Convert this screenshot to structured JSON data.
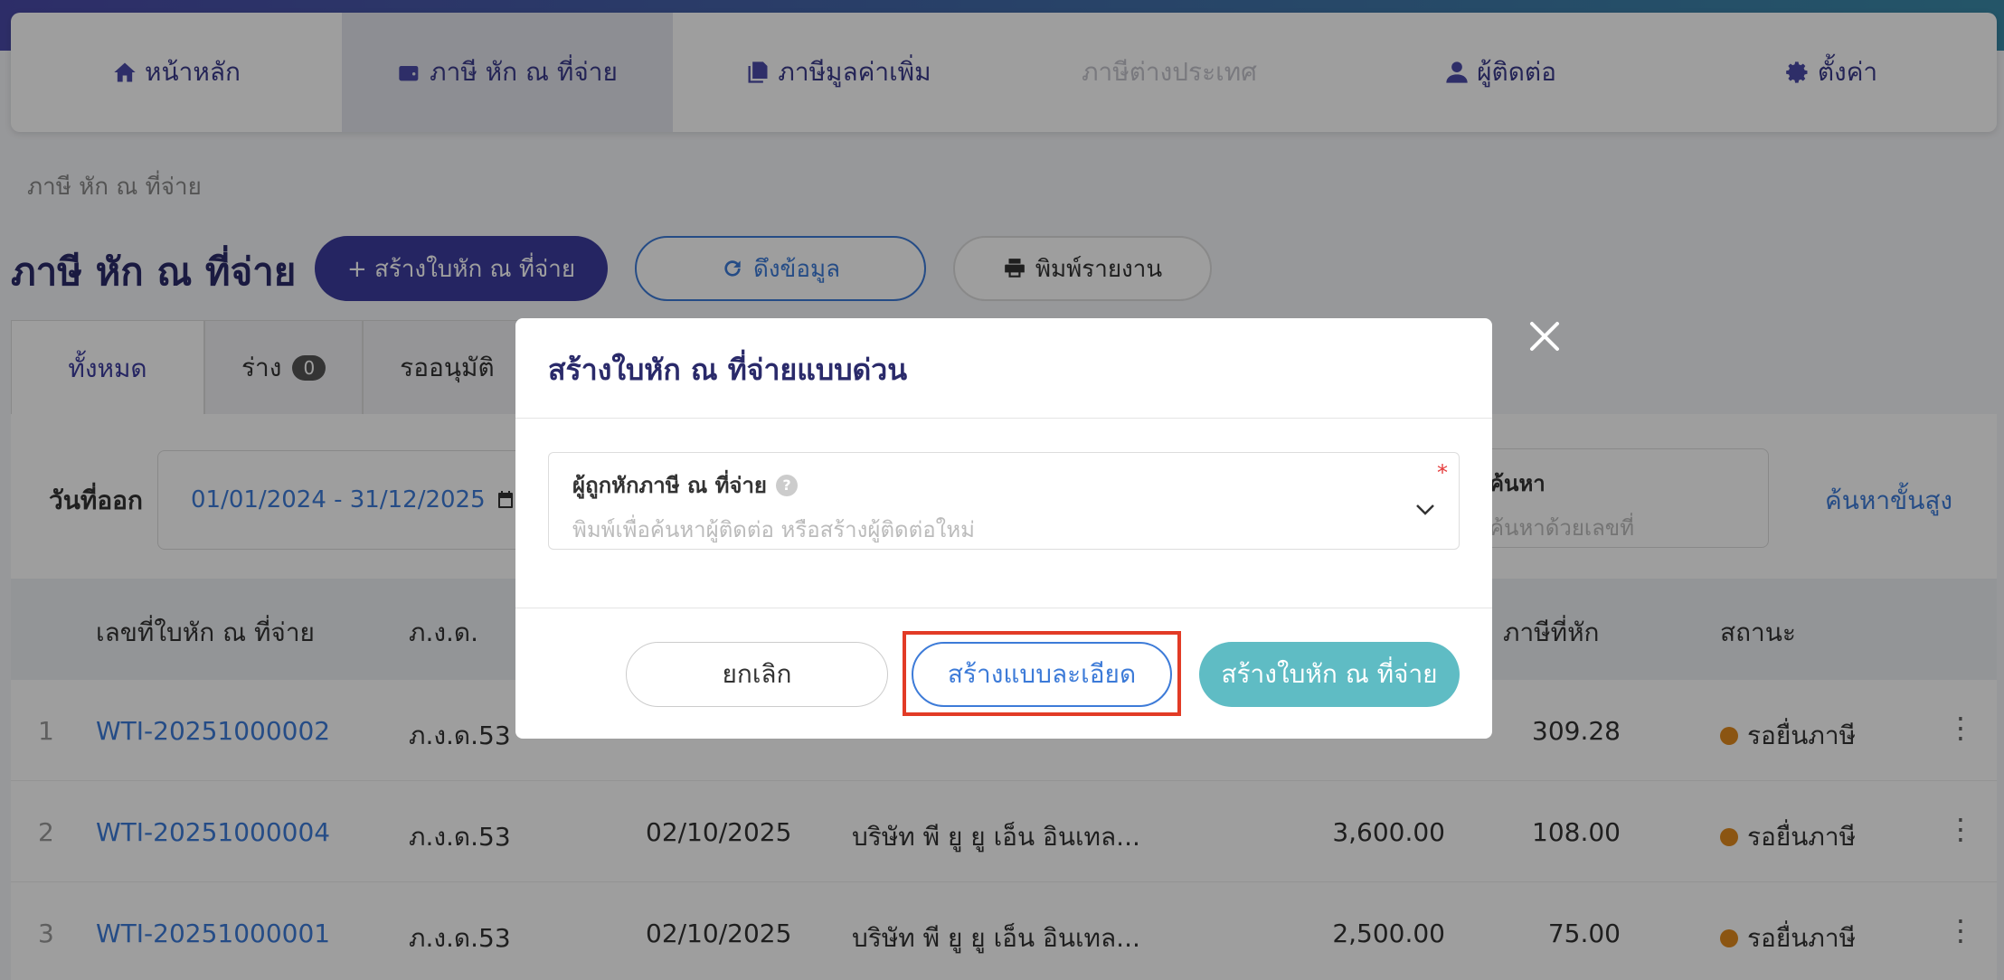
{
  "nav": {
    "items": [
      {
        "label": "หน้าหลัก",
        "icon": "home-icon"
      },
      {
        "label": "ภาษี หัก ณ ที่จ่าย",
        "icon": "wallet-icon"
      },
      {
        "label": "ภาษีมูลค่าเพิ่ม",
        "icon": "documents-icon"
      },
      {
        "label": "ภาษีต่างประเทศ",
        "icon": ""
      },
      {
        "label": "ผู้ติดต่อ",
        "icon": "user-icon"
      },
      {
        "label": "ตั้งค่า",
        "icon": "gear-icon"
      }
    ]
  },
  "breadcrumb": "ภาษี หัก ณ ที่จ่าย",
  "page": {
    "title": "ภาษี หัก ณ ที่จ่าย",
    "create_button": "+ สร้างใบหัก ณ ที่จ่าย",
    "fetch_button": "ดึงข้อมูล",
    "print_button": "พิมพ์รายงาน"
  },
  "tabs": [
    {
      "label": "ทั้งหมด"
    },
    {
      "label": "ร่าง",
      "count": "0"
    },
    {
      "label": "รออนุมัติ"
    }
  ],
  "filters": {
    "date_label": "วันที่ออก",
    "date_range": "01/01/2024 - 31/12/2025",
    "search_label": "ค้นหา",
    "search_placeholder": "ค้นหาด้วยเลขที่",
    "advanced_search": "ค้นหาขั้นสูง"
  },
  "table": {
    "headers": {
      "docno": "เลขที่ใบหัก ณ ที่จ่าย",
      "form": "ภ.ง.ด.",
      "tax": "ภาษีที่หัก",
      "status": "สถานะ"
    },
    "rows": [
      {
        "idx": "1",
        "docno": "WTI-20251000002",
        "form": "ภ.ง.ด.53",
        "date": "",
        "name": "",
        "amount": "",
        "tax": "309.28",
        "status": "รอยื่นภาษี"
      },
      {
        "idx": "2",
        "docno": "WTI-20251000004",
        "form": "ภ.ง.ด.53",
        "date": "02/10/2025",
        "name": "บริษัท พี ยู ยู เอ็น อินเทล...",
        "amount": "3,600.00",
        "tax": "108.00",
        "status": "รอยื่นภาษี"
      },
      {
        "idx": "3",
        "docno": "WTI-20251000001",
        "form": "ภ.ง.ด.53",
        "date": "02/10/2025",
        "name": "บริษัท พี ยู ยู เอ็น อินเทล...",
        "amount": "2,500.00",
        "tax": "75.00",
        "status": "รอยื่นภาษี"
      }
    ],
    "status_color": "#e08a1e"
  },
  "modal": {
    "title": "สร้างใบหัก ณ ที่จ่ายแบบด่วน",
    "field_label": "ผู้ถูกหักภาษี ณ ที่จ่าย",
    "field_placeholder": "พิมพ์เพื่อค้นหาผู้ติดต่อ หรือสร้างผู้ติดต่อใหม่",
    "required_mark": "*",
    "cancel": "ยกเลิก",
    "detailed": "สร้างแบบละเอียด",
    "quick_create": "สร้างใบหัก ณ ที่จ่าย"
  },
  "colors": {
    "primary": "#3d3d9e",
    "link": "#3d7bd8",
    "teal": "#5fbcc4",
    "highlight": "#e23b26"
  }
}
